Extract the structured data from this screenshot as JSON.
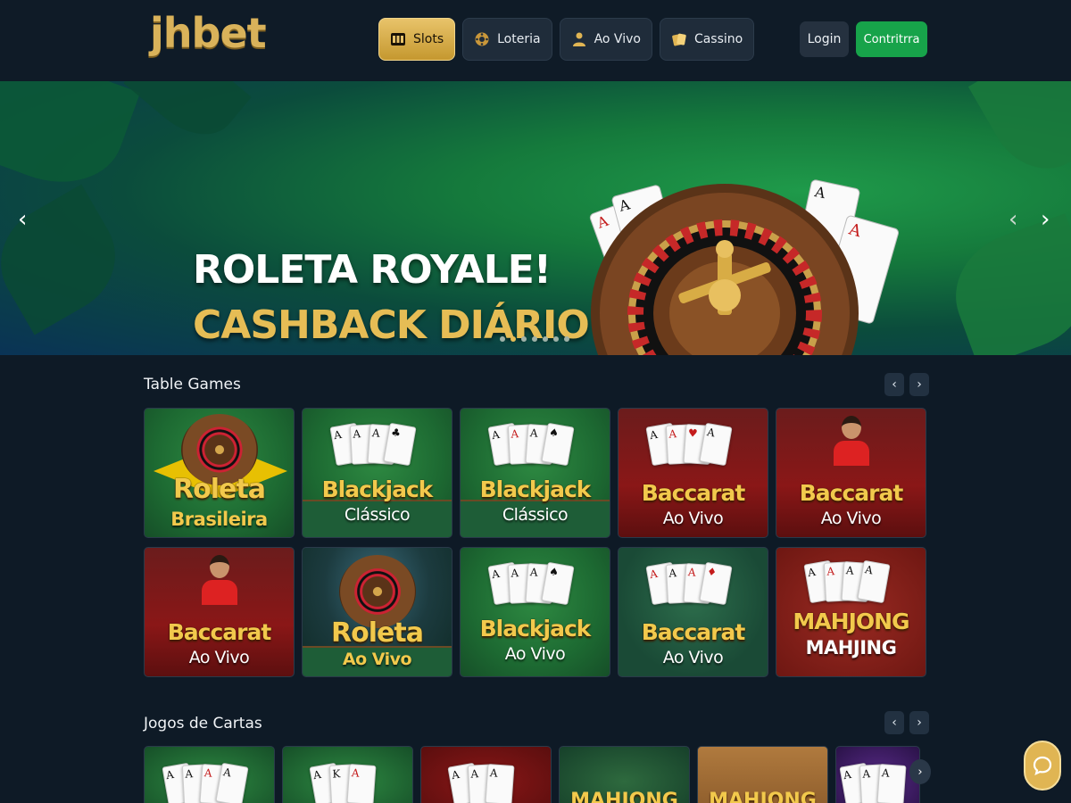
{
  "header": {
    "logo": "jhbet",
    "nav": [
      {
        "label": "Slots",
        "icon": "slots-icon",
        "active": true
      },
      {
        "label": "Loteria",
        "icon": "lottery-ball-icon",
        "active": false
      },
      {
        "label": "Ao Vivo",
        "icon": "live-dealer-icon",
        "active": false
      },
      {
        "label": "Cassino",
        "icon": "cards-icon",
        "active": false
      }
    ],
    "login_label": "Login",
    "signup_label": "Contritrra"
  },
  "banner": {
    "title_line1": "ROLETA ROYALE!",
    "title_line2": "CASHBACK DIÁRIO",
    "slide_count": 7,
    "active_slide": 2
  },
  "sections": {
    "table_games": {
      "title": "Table Games",
      "games": [
        {
          "line1": "Roleta",
          "line2": "Brasileira",
          "style": "brazil"
        },
        {
          "line1": "Blackjack",
          "line2": "Clássico",
          "style": "blackjack"
        },
        {
          "line1": "Blackjack",
          "line2": "Clássico",
          "style": "blackjack"
        },
        {
          "line1": "Baccarat",
          "line2": "Ao Vivo",
          "style": "baccarat-cards"
        },
        {
          "line1": "Baccarat",
          "line2": "Ao Vivo",
          "style": "baccarat-dealer"
        },
        {
          "line1": "Baccarat",
          "line2": "Ao Vivo",
          "style": "baccarat-dealer"
        },
        {
          "line1": "Roleta",
          "line2": "Ao Vivo",
          "style": "roulette-live"
        },
        {
          "line1": "Blackjack",
          "line2": "Ao Vivo",
          "style": "blackjack"
        },
        {
          "line1": "Baccarat",
          "line2": "Ao Vivo",
          "style": "baccarat-green"
        },
        {
          "line1": "MAHJONG",
          "line2": "MAHJING",
          "style": "mahjong"
        }
      ]
    },
    "card_games": {
      "title": "Jogos de Cartas",
      "games": [
        {
          "label": "",
          "style": "green"
        },
        {
          "label": "",
          "style": "green"
        },
        {
          "label": "",
          "style": "red"
        },
        {
          "label": "MAHJONG",
          "style": "mj"
        },
        {
          "label": "MAHJONG",
          "style": "wood"
        },
        {
          "label": "",
          "style": "purple"
        }
      ]
    }
  },
  "colors": {
    "gold": "#e6bd55",
    "green_button": "#17a34a",
    "background": "#0e1a26"
  }
}
